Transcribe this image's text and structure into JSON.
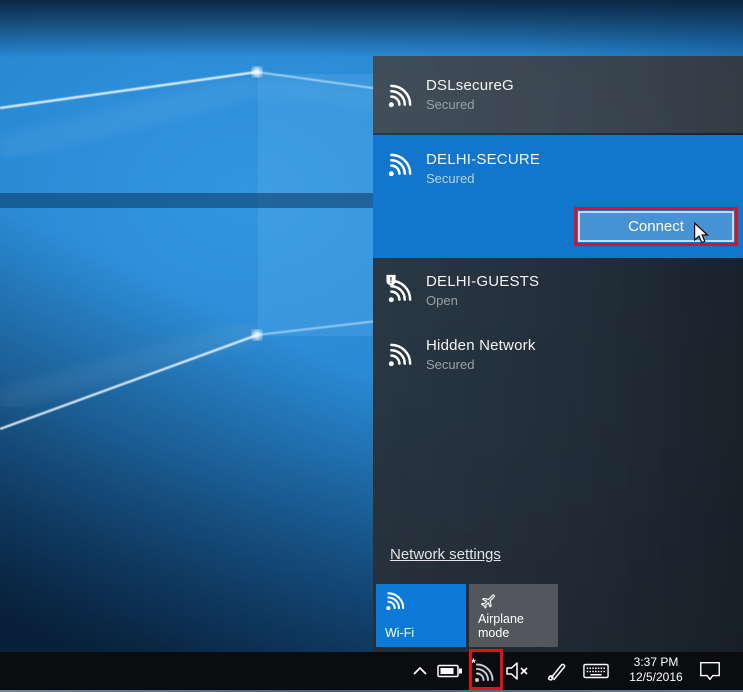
{
  "wifi_flyout": {
    "networks": [
      {
        "name": "DSLsecureG",
        "status": "Secured",
        "secured": true,
        "selected": false
      },
      {
        "name": "DELHI-SECURE",
        "status": "Secured",
        "secured": true,
        "selected": true,
        "connect_label": "Connect"
      },
      {
        "name": "DELHI-GUESTS",
        "status": "Open",
        "secured": false,
        "warning": true
      },
      {
        "name": "Hidden Network",
        "status": "Secured",
        "secured": true,
        "selected": false
      }
    ],
    "network_settings_label": "Network settings",
    "quick_actions": [
      {
        "label": "Wi-Fi",
        "state": "on"
      },
      {
        "label": "Airplane mode",
        "state": "off"
      }
    ]
  },
  "taskbar": {
    "time": "3:37 PM",
    "date": "12/5/2016",
    "tray_icons": [
      "chevron-up",
      "battery",
      "wifi-available",
      "volume-muted",
      "windows-ink",
      "touch-keyboard",
      "action-center"
    ]
  },
  "annotations": {
    "highlight_color": "#e01215",
    "highlighted": [
      "connect-button",
      "tray-wifi-icon"
    ]
  },
  "colors": {
    "accent_blue": "#1176cc",
    "tile_gray": "#53565a",
    "flyout_dark": "#23272c",
    "taskbar_black": "#0a0c0f"
  }
}
